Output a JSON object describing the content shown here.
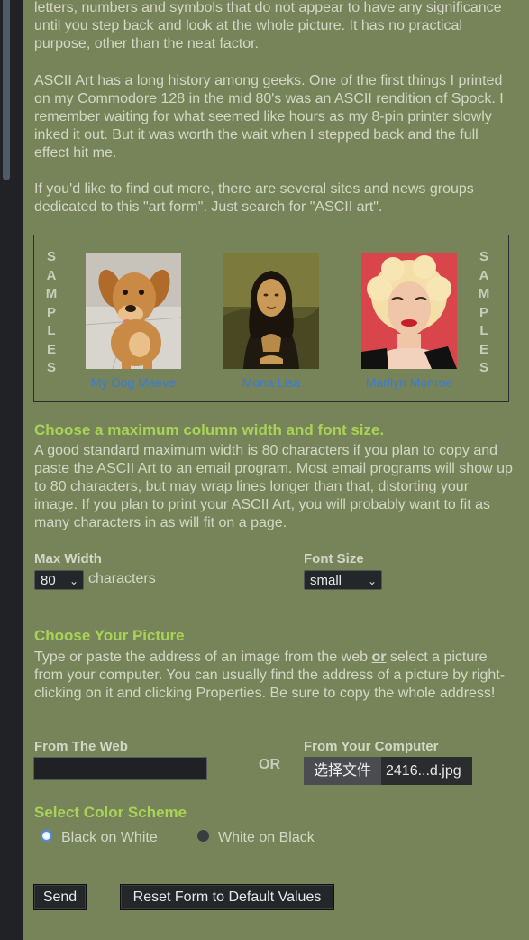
{
  "intro": {
    "p1_line": "letters, numbers and symbols that do not appear to have any significance until you step back and look at the whole picture. It has no practical purpose, other than the neat factor.",
    "p2": "ASCII Art has a long history among geeks. One of the first things I printed on my Commodore 128 in the mid 80's was an ASCII rendition of Spock. I remember waiting for what seemed like hours as my 8-pin printer slowly inked it out. But it was worth the wait when I stepped back and the full effect hit me.",
    "p3": "If you'd like to find out more, there are several sites and news groups dedicated to this \"art form\". Just search for \"ASCII art\"."
  },
  "samples": {
    "side_label_letters": [
      "S",
      "A",
      "M",
      "P",
      "L",
      "E",
      "S"
    ],
    "items": [
      {
        "caption": "My Dog Maeve",
        "icon": "dog-photo"
      },
      {
        "caption": "Mona Lisa",
        "icon": "mona-lisa-painting"
      },
      {
        "caption": "Marilyn Monroe",
        "icon": "marilyn-monroe-photo"
      }
    ]
  },
  "width_section": {
    "heading": "Choose a maximum column width and font size.",
    "body": "A good standard maximum width is 80 characters if you plan to copy and paste the ASCII Art to an email program. Most email programs will show up to 80 characters, but may wrap lines longer than that, distorting your image. If you plan to print your ASCII Art, you will probably want to fit as many characters in as will fit on a page.",
    "max_width_label": "Max Width",
    "max_width_value": "80",
    "characters_label": "characters",
    "font_size_label": "Font Size",
    "font_size_value": "small"
  },
  "picture_section": {
    "heading": "Choose Your Picture",
    "body_before": "Type or paste the address of an image from the web ",
    "body_or": "or",
    "body_after": " select a picture from your computer. You can usually find the address of a picture by right-clicking on it and clicking Properties. Be sure to copy the whole address!",
    "from_web_label": "From The Web",
    "url_value": "",
    "or_label": "OR",
    "from_computer_label": "From Your Computer",
    "choose_file_button": "选择文件",
    "file_name": "2416...d.jpg"
  },
  "color_section": {
    "heading": "Select Color Scheme",
    "options": [
      {
        "label": "Black on White",
        "selected": true
      },
      {
        "label": "White on Black",
        "selected": false
      }
    ]
  },
  "actions": {
    "send_label": "Send",
    "reset_label": "Reset Form to Default Values"
  },
  "colors": {
    "background": "#77845a",
    "heading": "#a9d356",
    "link": "#3a7bd5",
    "text": "#d4d7c5"
  }
}
